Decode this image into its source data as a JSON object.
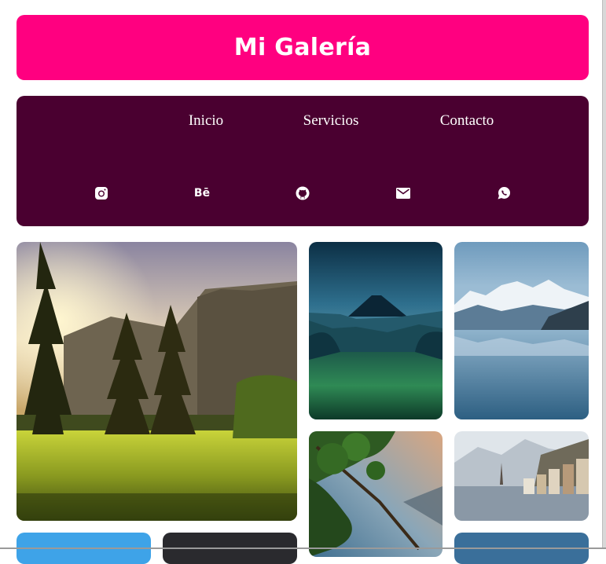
{
  "header": {
    "title": "Mi Galería"
  },
  "nav": {
    "links": [
      {
        "label": "Inicio"
      },
      {
        "label": "Servicios"
      },
      {
        "label": "Contacto"
      }
    ],
    "social": [
      {
        "icon": "instagram-icon"
      },
      {
        "icon": "behance-icon",
        "glyph": "Bē"
      },
      {
        "icon": "github-icon"
      },
      {
        "icon": "email-icon"
      },
      {
        "icon": "whatsapp-icon"
      }
    ]
  },
  "gallery": {
    "images": [
      {
        "subject": "forest-meadow-sunset"
      },
      {
        "subject": "night-volcano-valley"
      },
      {
        "subject": "mountain-lake-reflection"
      },
      {
        "subject": "tree-branches-sky"
      },
      {
        "subject": "lakeside-village"
      },
      {
        "subject": "blue-sky"
      },
      {
        "subject": "dark-scene"
      },
      {
        "subject": "blue-landscape"
      }
    ]
  },
  "colors": {
    "header_bg": "#ff0080",
    "nav_bg": "#4a0030",
    "text": "#ffffff"
  }
}
